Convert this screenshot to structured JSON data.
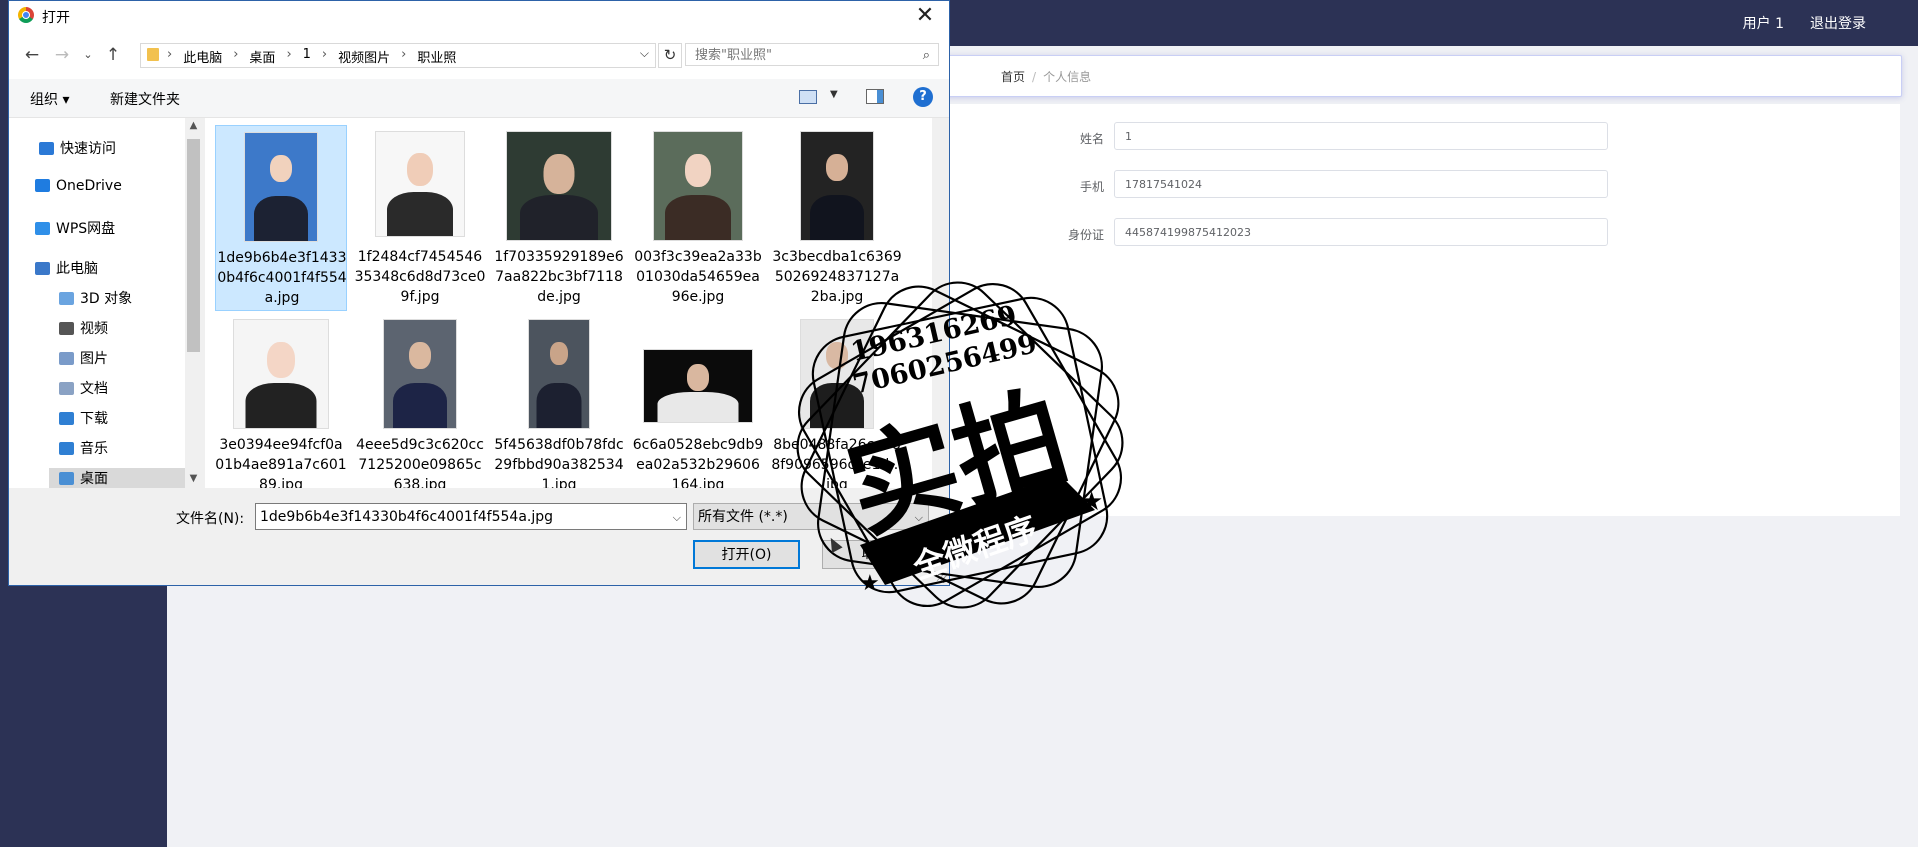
{
  "app": {
    "user_label": "用户 1",
    "logout_label": "退出登录",
    "breadcrumb": {
      "home": "首页",
      "sep": "/",
      "current": "个人信息"
    },
    "form": [
      {
        "label": "姓名",
        "value": "1"
      },
      {
        "label": "手机",
        "value": "17817541024"
      },
      {
        "label": "身份证",
        "value": "445874199875412023"
      }
    ]
  },
  "dialog": {
    "title": "打开",
    "path": [
      "此电脑",
      "桌面",
      "1",
      "视频图片",
      "职业照"
    ],
    "search_placeholder": "搜索\"职业照\"",
    "toolbar": {
      "organize": "组织 ▾",
      "new_folder": "新建文件夹",
      "help": "?"
    },
    "nav_items": [
      {
        "label": "快速访问",
        "icon": "star-icon",
        "color": "#2b79d6"
      },
      {
        "label": "OneDrive",
        "icon": "cloud-icon",
        "color": "#1f7ce0"
      },
      {
        "label": "WPS网盘",
        "icon": "cloud-icon",
        "color": "#2f8fe8"
      },
      {
        "label": "此电脑",
        "icon": "computer-icon",
        "color": "#3a78c9"
      },
      {
        "label": "3D 对象",
        "icon": "folder-3d-icon",
        "color": "#6aa4e0"
      },
      {
        "label": "视频",
        "icon": "video-folder-icon",
        "color": "#555555"
      },
      {
        "label": "图片",
        "icon": "pictures-folder-icon",
        "color": "#7a9bc9"
      },
      {
        "label": "文档",
        "icon": "documents-folder-icon",
        "color": "#8aa2c4"
      },
      {
        "label": "下载",
        "icon": "downloads-folder-icon",
        "color": "#2f7fd3"
      },
      {
        "label": "音乐",
        "icon": "music-folder-icon",
        "color": "#2f7fd3"
      },
      {
        "label": "桌面",
        "icon": "desktop-folder-icon",
        "color": "#4a8fd4"
      }
    ],
    "files": [
      {
        "name": "1de9b6b4e3f14330b4f6c4001f4f554a.jpg",
        "selected": true
      },
      {
        "name": "1f2484cf745454635348c6d8d73ce09f.jpg"
      },
      {
        "name": "1f70335929189e67aa822bc3bf7118de.jpg"
      },
      {
        "name": "003f3c39ea2a33b01030da54659ea96e.jpg"
      },
      {
        "name": "3c3becdba1c63695026924837127a2ba.jpg"
      },
      {
        "name": "3e0394ee94fcf0a01b4ae891a7c60189.jpg"
      },
      {
        "name": "4eee5d9c3c620cc7125200e09865c638.jpg"
      },
      {
        "name": "5f45638df0b78fdc29fbbd90a3825341.jpg"
      },
      {
        "name": "6c6a0528ebc9db9ea02a532b29606164.jpg"
      },
      {
        "name": "8be0488fa26ce988f9096596cce1d...jpg"
      }
    ],
    "filename_label": "文件名(N):",
    "filename_value": "1de9b6b4e3f14330b4f6c4001f4f554a.jpg",
    "filetype_value": "所有文件 (*.*)",
    "open_button": "打开(O)",
    "cancel_button": "取消"
  },
  "watermark": {
    "line1": "196316269",
    "line2": "7060256499",
    "big": "实拍",
    "banner": "全微程序"
  }
}
